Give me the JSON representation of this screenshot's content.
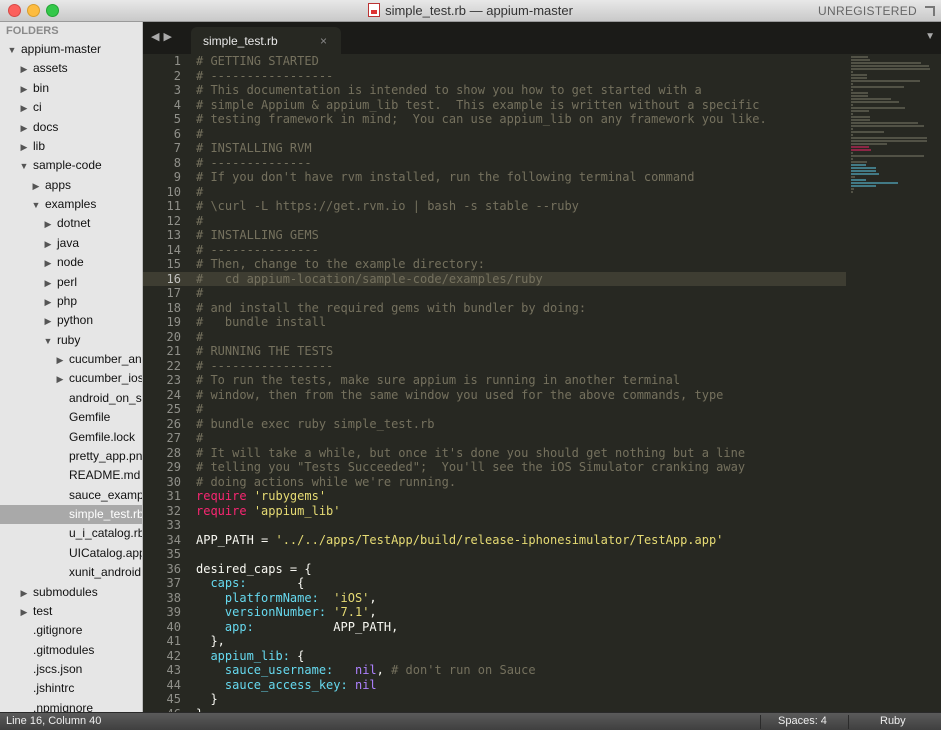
{
  "window": {
    "title": "simple_test.rb — appium-master",
    "license_status": "UNREGISTERED"
  },
  "sidebar": {
    "header": "FOLDERS",
    "items": [
      {
        "label": "appium-master",
        "depth": 0,
        "type": "folder",
        "expanded": true
      },
      {
        "label": "assets",
        "depth": 1,
        "type": "folder",
        "expanded": false
      },
      {
        "label": "bin",
        "depth": 1,
        "type": "folder",
        "expanded": false
      },
      {
        "label": "ci",
        "depth": 1,
        "type": "folder",
        "expanded": false
      },
      {
        "label": "docs",
        "depth": 1,
        "type": "folder",
        "expanded": false
      },
      {
        "label": "lib",
        "depth": 1,
        "type": "folder",
        "expanded": false
      },
      {
        "label": "sample-code",
        "depth": 1,
        "type": "folder",
        "expanded": true
      },
      {
        "label": "apps",
        "depth": 2,
        "type": "folder",
        "expanded": false
      },
      {
        "label": "examples",
        "depth": 2,
        "type": "folder",
        "expanded": true
      },
      {
        "label": "dotnet",
        "depth": 3,
        "type": "folder",
        "expanded": false
      },
      {
        "label": "java",
        "depth": 3,
        "type": "folder",
        "expanded": false
      },
      {
        "label": "node",
        "depth": 3,
        "type": "folder",
        "expanded": false
      },
      {
        "label": "perl",
        "depth": 3,
        "type": "folder",
        "expanded": false
      },
      {
        "label": "php",
        "depth": 3,
        "type": "folder",
        "expanded": false
      },
      {
        "label": "python",
        "depth": 3,
        "type": "folder",
        "expanded": false
      },
      {
        "label": "ruby",
        "depth": 3,
        "type": "folder",
        "expanded": true
      },
      {
        "label": "cucumber_and",
        "depth": 4,
        "type": "folder",
        "expanded": false
      },
      {
        "label": "cucumber_ios",
        "depth": 4,
        "type": "folder",
        "expanded": false
      },
      {
        "label": "android_on_sa",
        "depth": 4,
        "type": "file"
      },
      {
        "label": "Gemfile",
        "depth": 4,
        "type": "file"
      },
      {
        "label": "Gemfile.lock",
        "depth": 4,
        "type": "file"
      },
      {
        "label": "pretty_app.png",
        "depth": 4,
        "type": "file"
      },
      {
        "label": "README.md",
        "depth": 4,
        "type": "file"
      },
      {
        "label": "sauce_exampl",
        "depth": 4,
        "type": "file"
      },
      {
        "label": "simple_test.rb",
        "depth": 4,
        "type": "file",
        "selected": true
      },
      {
        "label": "u_i_catalog.rb",
        "depth": 4,
        "type": "file"
      },
      {
        "label": "UICatalog.app",
        "depth": 4,
        "type": "file"
      },
      {
        "label": "xunit_android.",
        "depth": 4,
        "type": "file"
      },
      {
        "label": "submodules",
        "depth": 1,
        "type": "folder",
        "expanded": false
      },
      {
        "label": "test",
        "depth": 1,
        "type": "folder",
        "expanded": false
      },
      {
        "label": ".gitignore",
        "depth": 1,
        "type": "file"
      },
      {
        "label": ".gitmodules",
        "depth": 1,
        "type": "file"
      },
      {
        "label": ".jscs.json",
        "depth": 1,
        "type": "file"
      },
      {
        "label": ".jshintrc",
        "depth": 1,
        "type": "file"
      },
      {
        "label": ".npmignore",
        "depth": 1,
        "type": "file"
      }
    ]
  },
  "tabs": [
    {
      "label": "simple_test.rb",
      "active": true
    }
  ],
  "editor": {
    "active_line": 16,
    "lines": [
      [
        [
          "c",
          "# GETTING STARTED"
        ]
      ],
      [
        [
          "c",
          "# -----------------"
        ]
      ],
      [
        [
          "c",
          "# This documentation is intended to show you how to get started with a"
        ]
      ],
      [
        [
          "c",
          "# simple Appium & appium_lib test.  This example is written without a specific"
        ]
      ],
      [
        [
          "c",
          "# testing framework in mind;  You can use appium_lib on any framework you like."
        ]
      ],
      [
        [
          "c",
          "#"
        ]
      ],
      [
        [
          "c",
          "# INSTALLING RVM"
        ]
      ],
      [
        [
          "c",
          "# --------------"
        ]
      ],
      [
        [
          "c",
          "# If you don't have rvm installed, run the following terminal command"
        ]
      ],
      [
        [
          "c",
          "#"
        ]
      ],
      [
        [
          "c",
          "# \\curl -L https://get.rvm.io | bash -s stable --ruby"
        ]
      ],
      [
        [
          "c",
          "#"
        ]
      ],
      [
        [
          "c",
          "# INSTALLING GEMS"
        ]
      ],
      [
        [
          "c",
          "# ---------------"
        ]
      ],
      [
        [
          "c",
          "# Then, change to the example directory:"
        ]
      ],
      [
        [
          "c",
          "#   cd appium-location/sample-code/examples/ruby"
        ]
      ],
      [
        [
          "c",
          "#"
        ]
      ],
      [
        [
          "c",
          "# and install the required gems with bundler by doing:"
        ]
      ],
      [
        [
          "c",
          "#   bundle install"
        ]
      ],
      [
        [
          "c",
          "#"
        ]
      ],
      [
        [
          "c",
          "# RUNNING THE TESTS"
        ]
      ],
      [
        [
          "c",
          "# -----------------"
        ]
      ],
      [
        [
          "c",
          "# To run the tests, make sure appium is running in another terminal"
        ]
      ],
      [
        [
          "c",
          "# window, then from the same window you used for the above commands, type"
        ]
      ],
      [
        [
          "c",
          "#"
        ]
      ],
      [
        [
          "c",
          "# bundle exec ruby simple_test.rb"
        ]
      ],
      [
        [
          "c",
          "#"
        ]
      ],
      [
        [
          "c",
          "# It will take a while, but once it's done you should get nothing but a line"
        ]
      ],
      [
        [
          "c",
          "# telling you \"Tests Succeeded\";  You'll see the iOS Simulator cranking away"
        ]
      ],
      [
        [
          "c",
          "# doing actions while we're running."
        ]
      ],
      [
        [
          "k",
          "require"
        ],
        [
          "p",
          " "
        ],
        [
          "s",
          "'rubygems'"
        ]
      ],
      [
        [
          "k",
          "require"
        ],
        [
          "p",
          " "
        ],
        [
          "s",
          "'appium_lib'"
        ]
      ],
      [
        [
          "p",
          ""
        ]
      ],
      [
        [
          "p",
          "APP_PATH = "
        ],
        [
          "s",
          "'../../apps/TestApp/build/release-iphonesimulator/TestApp.app'"
        ]
      ],
      [
        [
          "p",
          ""
        ]
      ],
      [
        [
          "p",
          "desired_caps = {"
        ]
      ],
      [
        [
          "p",
          "  "
        ],
        [
          "y",
          "caps:"
        ],
        [
          "p",
          "       {"
        ]
      ],
      [
        [
          "p",
          "    "
        ],
        [
          "y",
          "platformName:"
        ],
        [
          "p",
          "  "
        ],
        [
          "s",
          "'iOS'"
        ],
        [
          "p",
          ","
        ]
      ],
      [
        [
          "p",
          "    "
        ],
        [
          "y",
          "versionNumber:"
        ],
        [
          "p",
          " "
        ],
        [
          "s",
          "'7.1'"
        ],
        [
          "p",
          ","
        ]
      ],
      [
        [
          "p",
          "    "
        ],
        [
          "y",
          "app:"
        ],
        [
          "p",
          "           APP_PATH,"
        ]
      ],
      [
        [
          "p",
          "  },"
        ]
      ],
      [
        [
          "p",
          "  "
        ],
        [
          "y",
          "appium_lib:"
        ],
        [
          "p",
          " {"
        ]
      ],
      [
        [
          "p",
          "    "
        ],
        [
          "y",
          "sauce_username:"
        ],
        [
          "p",
          "   "
        ],
        [
          "n",
          "nil"
        ],
        [
          "p",
          ", "
        ],
        [
          "c",
          "# don't run on Sauce"
        ]
      ],
      [
        [
          "p",
          "    "
        ],
        [
          "y",
          "sauce_access_key:"
        ],
        [
          "p",
          " "
        ],
        [
          "n",
          "nil"
        ]
      ],
      [
        [
          "p",
          "  }"
        ]
      ],
      [
        [
          "p",
          "}"
        ]
      ]
    ]
  },
  "status": {
    "position": "Line 16, Column 40",
    "indentation": "Spaces: 4",
    "syntax": "Ruby"
  },
  "colors": {
    "editor_bg": "#272822",
    "comment": "#75715e",
    "keyword": "#f92672",
    "string": "#e6db74",
    "symbol": "#ae81ff"
  }
}
